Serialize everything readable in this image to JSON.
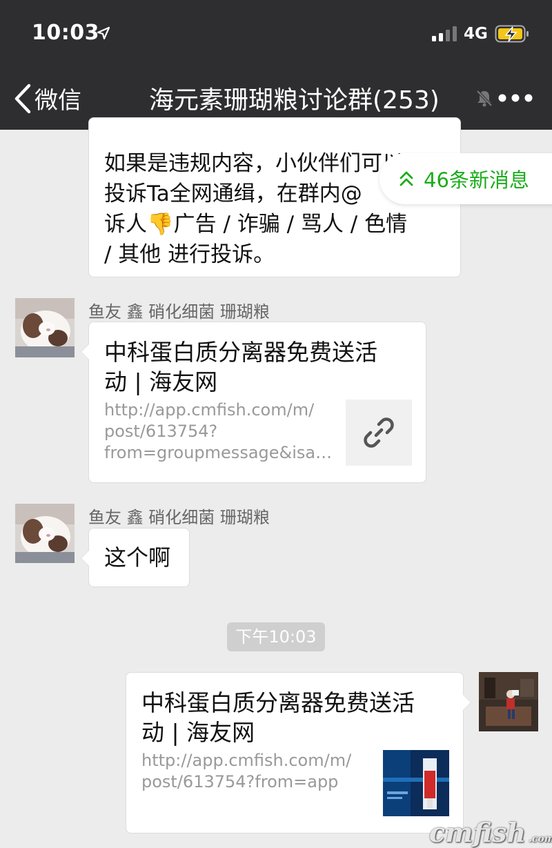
{
  "status_bar": {
    "time": "10:03",
    "network": "4G"
  },
  "header": {
    "back_label": "微信",
    "title": "海元素珊瑚粮讨论群(253)"
  },
  "new_messages": {
    "label": "46条新消息"
  },
  "messages": [
    {
      "type": "text",
      "lines": [
        "如果是违规内容，小伙伴们可以",
        "投诉Ta全网通缉，在群内@",
        "诉人",
        "广告 / 诈骗 / 骂人 / 色情",
        "/ 其他 进行投诉。"
      ],
      "emoji": "👎"
    },
    {
      "type": "link",
      "sender": "鱼友 鑫 硝化细菌 珊瑚粮",
      "title_lines": [
        "中科蛋白质分离器免费送活",
        "动 | 海友网"
      ],
      "url_lines": [
        "http://app.cmfish.com/m/",
        "post/613754?",
        "from=groupmessage&isa…"
      ],
      "thumb_icon": "link-icon"
    },
    {
      "type": "text",
      "sender": "鱼友 鑫 硝化细菌 珊瑚粮",
      "text": "这个啊"
    },
    {
      "type": "timestamp",
      "text": "下午10:03"
    },
    {
      "type": "link",
      "outgoing": true,
      "title_lines": [
        "中科蛋白质分离器免费送活",
        "动 | 海友网"
      ],
      "url_lines": [
        "http://app.cmfish.com/m/",
        "post/613754?from=app"
      ]
    }
  ],
  "watermark": {
    "text": "cmfish",
    "suffix": ".com"
  },
  "colors": {
    "topbar": "#2e2e30",
    "background": "#ececec",
    "accent_green": "#1aad19",
    "battery": "#f5c518"
  }
}
